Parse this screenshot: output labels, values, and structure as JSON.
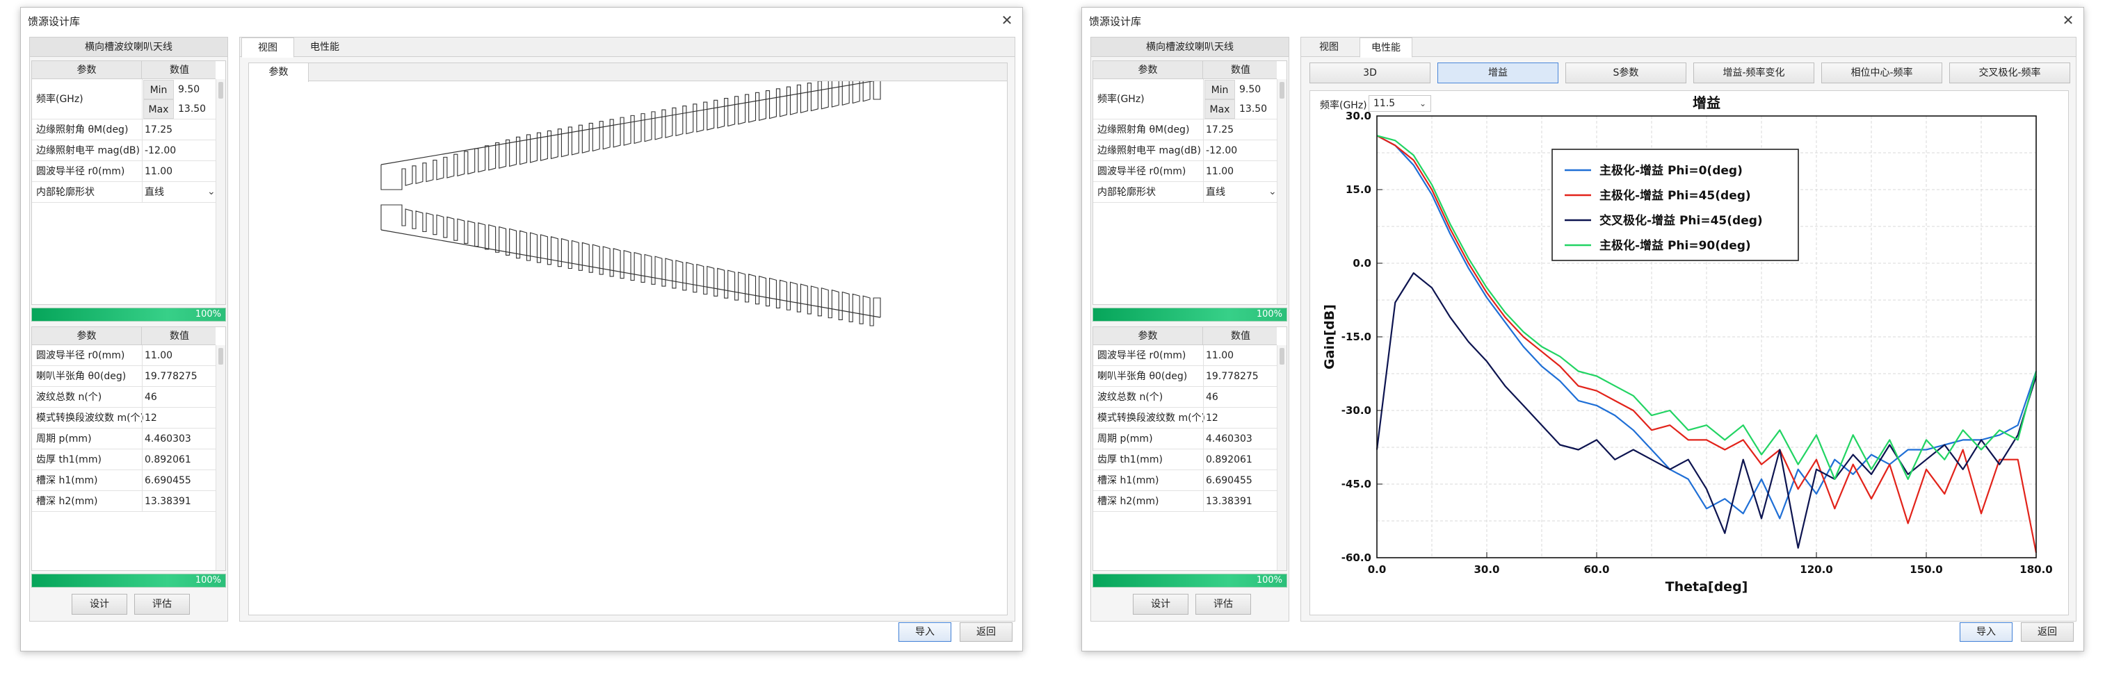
{
  "left": {
    "window_title": "馈源设计库",
    "panel_title": "横向槽波纹喇叭天线",
    "headers": {
      "param": "参数",
      "value": "数值"
    },
    "freq_label": "频率(GHz)",
    "min_label": "Min",
    "min_value": "9.50",
    "max_label": "Max",
    "max_value": "13.50",
    "params_top": [
      {
        "name": "边缘照射角 θM(deg)",
        "value": "17.25"
      },
      {
        "name": "边缘照射电平 mag(dB)",
        "value": "-12.00"
      },
      {
        "name": "圆波导半径 r0(mm)",
        "value": "11.00"
      },
      {
        "name": "内部轮廓形状",
        "value": "直线"
      }
    ],
    "progress_top": "100%",
    "params_bottom": [
      {
        "name": "圆波导半径 r0(mm)",
        "value": "11.00"
      },
      {
        "name": "喇叭半张角 θ0(deg)",
        "value": "19.778275"
      },
      {
        "name": "波纹总数 n(个)",
        "value": "46"
      },
      {
        "name": "模式转换段波纹数 m(个)",
        "value": "12"
      },
      {
        "name": "周期 p(mm)",
        "value": "4.460303"
      },
      {
        "name": "齿厚 th1(mm)",
        "value": "0.892061"
      },
      {
        "name": "槽深 h1(mm)",
        "value": "6.690455"
      },
      {
        "name": "槽深 h2(mm)",
        "value": "13.38391"
      }
    ],
    "progress_bottom": "100%",
    "design_button": "设计",
    "eval_button": "评估",
    "tabs": [
      "视图",
      "电性能"
    ],
    "sub_tab": "参数",
    "import_button": "导入",
    "back_button": "返回"
  },
  "right": {
    "window_title": "馈源设计库",
    "panel_title": "横向槽波纹喇叭天线",
    "headers": {
      "param": "参数",
      "value": "数值"
    },
    "freq_label": "频率(GHz)",
    "min_label": "Min",
    "min_value": "9.50",
    "max_label": "Max",
    "max_value": "13.50",
    "params_top": [
      {
        "name": "边缘照射角 θM(deg)",
        "value": "17.25"
      },
      {
        "name": "边缘照射电平 mag(dB)",
        "value": "-12.00"
      },
      {
        "name": "圆波导半径 r0(mm)",
        "value": "11.00"
      },
      {
        "name": "内部轮廓形状",
        "value": "直线"
      }
    ],
    "progress_top": "100%",
    "params_bottom": [
      {
        "name": "圆波导半径 r0(mm)",
        "value": "11.00"
      },
      {
        "name": "喇叭半张角 θ0(deg)",
        "value": "19.778275"
      },
      {
        "name": "波纹总数 n(个)",
        "value": "46"
      },
      {
        "name": "模式转换段波纹数 m(个)",
        "value": "12"
      },
      {
        "name": "周期 p(mm)",
        "value": "4.460303"
      },
      {
        "name": "齿厚 th1(mm)",
        "value": "0.892061"
      },
      {
        "name": "槽深 h1(mm)",
        "value": "6.690455"
      },
      {
        "name": "槽深 h2(mm)",
        "value": "13.38391"
      }
    ],
    "progress_bottom": "100%",
    "design_button": "设计",
    "eval_button": "评估",
    "tabs": [
      "视图",
      "电性能"
    ],
    "perf_buttons": [
      "3D",
      "增益",
      "S参数",
      "增益-频率变化",
      "相位中心-频率",
      "交叉极化-频率"
    ],
    "freq_select_label": "频率(GHz)",
    "freq_select_value": "11.5",
    "import_button": "导入",
    "back_button": "返回"
  },
  "colors": {
    "progress": "#1cc07a",
    "series_blue": "#1f6fd6",
    "series_red": "#e2231a",
    "series_navy": "#0d1450",
    "series_green": "#22d463"
  },
  "chart_data": {
    "type": "line",
    "title": "增益",
    "xlabel": "Theta[deg]",
    "ylabel": "Gain[dB]",
    "xlim": [
      0,
      180
    ],
    "ylim": [
      -60,
      30
    ],
    "xticks": [
      "0.0",
      "30.0",
      "60.0",
      "120.0",
      "150.0",
      "180.0"
    ],
    "xtick_values": [
      0,
      30,
      60,
      120,
      150,
      180
    ],
    "yticks": [
      "30.0",
      "15.0",
      "0.0",
      "-15.0",
      "-30.0",
      "-45.0",
      "-60.0"
    ],
    "ytick_values": [
      30,
      15,
      0,
      -15,
      -30,
      -45,
      -60
    ],
    "grid": true,
    "legend": "top-left",
    "x": [
      0,
      5,
      10,
      15,
      20,
      25,
      30,
      35,
      40,
      45,
      50,
      55,
      60,
      65,
      70,
      75,
      80,
      85,
      90,
      95,
      100,
      105,
      110,
      115,
      120,
      125,
      130,
      135,
      140,
      145,
      150,
      155,
      160,
      165,
      170,
      175,
      180
    ],
    "series": [
      {
        "name": "主极化-增益 Phi=0(deg)",
        "color": "#1f6fd6",
        "values": [
          26,
          24,
          20,
          14,
          6,
          -1,
          -7,
          -12,
          -17,
          -21,
          -24,
          -28,
          -29,
          -31,
          -34,
          -38,
          -42,
          -44,
          -50,
          -48,
          -51,
          -44,
          -52,
          -42,
          -47,
          -40,
          -43,
          -39,
          -41,
          -38,
          -38,
          -37,
          -36,
          -36,
          -35,
          -33,
          -22
        ]
      },
      {
        "name": "主极化-增益 Phi=45(deg)",
        "color": "#e2231a",
        "values": [
          26,
          24,
          21,
          15,
          7,
          0,
          -6,
          -11,
          -15,
          -18,
          -21,
          -25,
          -26,
          -28,
          -30,
          -34,
          -33,
          -36,
          -36,
          -38,
          -36,
          -41,
          -38,
          -46,
          -40,
          -50,
          -41,
          -48,
          -41,
          -53,
          -42,
          -47,
          -38,
          -51,
          -40,
          -40,
          -59
        ]
      },
      {
        "name": "交叉极化-增益 Phi=45(deg)",
        "color": "#0d1450",
        "values": [
          -38,
          -8,
          -2,
          -5,
          -11,
          -16,
          -20,
          -25,
          -29,
          -33,
          -37,
          -38,
          -36,
          -40,
          -38,
          -40,
          -42,
          -40,
          -46,
          -55,
          -40,
          -52,
          -38,
          -58,
          -42,
          -44,
          -39,
          -43,
          -37,
          -43,
          -40,
          -37,
          -42,
          -36,
          -41,
          -35,
          -23
        ]
      },
      {
        "name": "主极化-增益 Phi=90(deg)",
        "color": "#22d463",
        "values": [
          26,
          25,
          22,
          16,
          8,
          1,
          -5,
          -10,
          -14,
          -17,
          -19,
          -22,
          -23,
          -25,
          -27,
          -31,
          -30,
          -34,
          -33,
          -36,
          -33,
          -39,
          -34,
          -41,
          -35,
          -44,
          -35,
          -42,
          -36,
          -44,
          -36,
          -40,
          -34,
          -38,
          -34,
          -36,
          -22
        ]
      }
    ]
  }
}
